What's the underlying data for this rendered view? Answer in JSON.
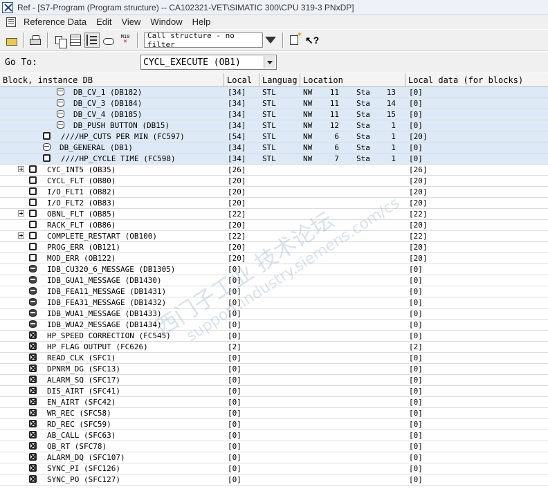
{
  "window": {
    "title": "Ref - [S7-Program (Program structure) -- CA102321-VET\\SIMATIC 300\\CPU 319-3 PNxDP]"
  },
  "menu": {
    "items": [
      "Reference Data",
      "Edit",
      "View",
      "Window",
      "Help"
    ]
  },
  "toolbar": {
    "icons": [
      "open-icon",
      "print-icon",
      "copy-icon",
      "grid-view-icon",
      "tree-view-icon",
      "connection-icon",
      "m10-icon",
      "filter-icon",
      "new-window-icon",
      "help-icon"
    ],
    "filter_text": "Call structure - no filter",
    "m10_label": "M10"
  },
  "goto": {
    "label": "Go To:",
    "selected": "CYCL_EXECUTE (OB1)"
  },
  "grid": {
    "headers": {
      "block": "Block, instance DB",
      "local": "Local",
      "language": "Languag",
      "location": "Location",
      "local_data": "Local data (for blocks)"
    },
    "rows": [
      {
        "icon": "db",
        "name": "DB_CV_1 (DB182)",
        "local": "[34]",
        "lang": "STL",
        "loc_a": "NW",
        "loc_b": "11",
        "loc_c": "Sta",
        "loc_d": "13",
        "data": "[0]"
      },
      {
        "icon": "db",
        "name": "DB_CV_3 (DB184)",
        "local": "[34]",
        "lang": "STL",
        "loc_a": "NW",
        "loc_b": "11",
        "loc_c": "Sta",
        "loc_d": "14",
        "data": "[0]"
      },
      {
        "icon": "db",
        "name": "DB_CV_4 (DB185)",
        "local": "[34]",
        "lang": "STL",
        "loc_a": "NW",
        "loc_b": "11",
        "loc_c": "Sta",
        "loc_d": "15",
        "data": "[0]"
      },
      {
        "icon": "db",
        "name": "DB_PUSH BUTTON (DB15)",
        "local": "[34]",
        "lang": "STL",
        "loc_a": "NW",
        "loc_b": "12",
        "loc_c": "Sta",
        "loc_d": "1",
        "data": "[0]"
      },
      {
        "icon": "fc",
        "name": "////HP_CUTS PER MIN (FC597)",
        "local": "[54]",
        "lang": "STL",
        "loc_a": "NW",
        "loc_b": "6",
        "loc_c": "Sta",
        "loc_d": "1",
        "data": "[20]"
      },
      {
        "icon": "db",
        "name": "DB_GENERAL (DB1)",
        "local": "[34]",
        "lang": "STL",
        "loc_a": "NW",
        "loc_b": "6",
        "loc_c": "Sta",
        "loc_d": "1",
        "data": "[0]"
      },
      {
        "icon": "fc",
        "name": "////HP_CYCLE TIME (FC598)",
        "local": "[34]",
        "lang": "STL",
        "loc_a": "NW",
        "loc_b": "7",
        "loc_c": "Sta",
        "loc_d": "1",
        "data": "[0]"
      },
      {
        "icon": "ob",
        "expander": true,
        "name": "CYC_INT5 (OB35)",
        "local": "[26]",
        "lang": "",
        "loc_a": "",
        "loc_b": "",
        "loc_c": "",
        "loc_d": "",
        "data": "[26]"
      },
      {
        "icon": "ob",
        "name": "CYCL_FLT (OB80)",
        "local": "[20]",
        "lang": "",
        "loc_a": "",
        "loc_b": "",
        "loc_c": "",
        "loc_d": "",
        "data": "[20]"
      },
      {
        "icon": "ob",
        "name": "I/O_FLT1 (OB82)",
        "local": "[20]",
        "lang": "",
        "loc_a": "",
        "loc_b": "",
        "loc_c": "",
        "loc_d": "",
        "data": "[20]"
      },
      {
        "icon": "ob",
        "name": "I/O_FLT2 (OB83)",
        "local": "[20]",
        "lang": "",
        "loc_a": "",
        "loc_b": "",
        "loc_c": "",
        "loc_d": "",
        "data": "[20]"
      },
      {
        "icon": "ob",
        "expander": true,
        "name": "OBNL_FLT (OB85)",
        "local": "[22]",
        "lang": "",
        "loc_a": "",
        "loc_b": "",
        "loc_c": "",
        "loc_d": "",
        "data": "[22]"
      },
      {
        "icon": "ob",
        "name": "RACK_FLT (OB86)",
        "local": "[20]",
        "lang": "",
        "loc_a": "",
        "loc_b": "",
        "loc_c": "",
        "loc_d": "",
        "data": "[20]"
      },
      {
        "icon": "ob",
        "expander": true,
        "name": "COMPLETE_RESTART (OB100)",
        "local": "[22]",
        "lang": "",
        "loc_a": "",
        "loc_b": "",
        "loc_c": "",
        "loc_d": "",
        "data": "[22]"
      },
      {
        "icon": "ob",
        "name": "PROG_ERR (OB121)",
        "local": "[20]",
        "lang": "",
        "loc_a": "",
        "loc_b": "",
        "loc_c": "",
        "loc_d": "",
        "data": "[20]"
      },
      {
        "icon": "ob",
        "name": "MOD_ERR (OB122)",
        "local": "[20]",
        "lang": "",
        "loc_a": "",
        "loc_b": "",
        "loc_c": "",
        "loc_d": "",
        "data": "[20]"
      },
      {
        "icon": "dbf",
        "name": "IDB_CU320_6_MESSAGE (DB1305)",
        "local": "[0]",
        "lang": "",
        "loc_a": "",
        "loc_b": "",
        "loc_c": "",
        "loc_d": "",
        "data": "[0]"
      },
      {
        "icon": "dbf",
        "name": "IDB_GUA1_MESSAGE (DB1430)",
        "local": "[0]",
        "lang": "",
        "loc_a": "",
        "loc_b": "",
        "loc_c": "",
        "loc_d": "",
        "data": "[0]"
      },
      {
        "icon": "dbf",
        "name": "IDB_FEA11_MESSAGE (DB1431)",
        "local": "[0]",
        "lang": "",
        "loc_a": "",
        "loc_b": "",
        "loc_c": "",
        "loc_d": "",
        "data": "[0]"
      },
      {
        "icon": "dbf",
        "name": "IDB_FEA31_MESSAGE (DB1432)",
        "local": "[0]",
        "lang": "",
        "loc_a": "",
        "loc_b": "",
        "loc_c": "",
        "loc_d": "",
        "data": "[0]"
      },
      {
        "icon": "dbf",
        "name": "IDB_WUA1_MESSAGE (DB1433)",
        "local": "[0]",
        "lang": "",
        "loc_a": "",
        "loc_b": "",
        "loc_c": "",
        "loc_d": "",
        "data": "[0]"
      },
      {
        "icon": "dbf",
        "name": "IDB_WUA2_MESSAGE (DB1434)",
        "local": "[0]",
        "lang": "",
        "loc_a": "",
        "loc_b": "",
        "loc_c": "",
        "loc_d": "",
        "data": "[0]"
      },
      {
        "icon": "sfc",
        "name": "HP_SPEED CORRECTION (FC545)",
        "local": "[0]",
        "lang": "",
        "loc_a": "",
        "loc_b": "",
        "loc_c": "",
        "loc_d": "",
        "data": "[0]"
      },
      {
        "icon": "sfc",
        "name": "HP_FLAG OUTPUT (FC626)",
        "local": "[2]",
        "lang": "",
        "loc_a": "",
        "loc_b": "",
        "loc_c": "",
        "loc_d": "",
        "data": "[2]"
      },
      {
        "icon": "sfc",
        "name": "READ_CLK (SFC1)",
        "local": "[0]",
        "lang": "",
        "loc_a": "",
        "loc_b": "",
        "loc_c": "",
        "loc_d": "",
        "data": "[0]"
      },
      {
        "icon": "sfc",
        "name": "DPNRM_DG (SFC13)",
        "local": "[0]",
        "lang": "",
        "loc_a": "",
        "loc_b": "",
        "loc_c": "",
        "loc_d": "",
        "data": "[0]"
      },
      {
        "icon": "sfc",
        "name": "ALARM_SQ (SFC17)",
        "local": "[0]",
        "lang": "",
        "loc_a": "",
        "loc_b": "",
        "loc_c": "",
        "loc_d": "",
        "data": "[0]"
      },
      {
        "icon": "sfc",
        "name": "DIS_AIRT (SFC41)",
        "local": "[0]",
        "lang": "",
        "loc_a": "",
        "loc_b": "",
        "loc_c": "",
        "loc_d": "",
        "data": "[0]"
      },
      {
        "icon": "sfc",
        "name": "EN_AIRT (SFC42)",
        "local": "[0]",
        "lang": "",
        "loc_a": "",
        "loc_b": "",
        "loc_c": "",
        "loc_d": "",
        "data": "[0]"
      },
      {
        "icon": "sfc",
        "name": "WR_REC (SFC58)",
        "local": "[0]",
        "lang": "",
        "loc_a": "",
        "loc_b": "",
        "loc_c": "",
        "loc_d": "",
        "data": "[0]"
      },
      {
        "icon": "sfc",
        "name": "RD_REC (SFC59)",
        "local": "[0]",
        "lang": "",
        "loc_a": "",
        "loc_b": "",
        "loc_c": "",
        "loc_d": "",
        "data": "[0]"
      },
      {
        "icon": "sfc",
        "name": "AB_CALL (SFC63)",
        "local": "[0]",
        "lang": "",
        "loc_a": "",
        "loc_b": "",
        "loc_c": "",
        "loc_d": "",
        "data": "[0]"
      },
      {
        "icon": "sfc",
        "name": "OB_RT (SFC78)",
        "local": "[0]",
        "lang": "",
        "loc_a": "",
        "loc_b": "",
        "loc_c": "",
        "loc_d": "",
        "data": "[0]"
      },
      {
        "icon": "sfc",
        "name": "ALARM_DQ (SFC107)",
        "local": "[0]",
        "lang": "",
        "loc_a": "",
        "loc_b": "",
        "loc_c": "",
        "loc_d": "",
        "data": "[0]"
      },
      {
        "icon": "sfc",
        "name": "SYNC_PI (SFC126)",
        "local": "[0]",
        "lang": "",
        "loc_a": "",
        "loc_b": "",
        "loc_c": "",
        "loc_d": "",
        "data": "[0]"
      },
      {
        "icon": "sfc",
        "name": "SYNC_PO (SFC127)",
        "local": "[0]",
        "lang": "",
        "loc_a": "",
        "loc_b": "",
        "loc_c": "",
        "loc_d": "",
        "data": "[0]"
      }
    ]
  },
  "watermark": {
    "line1": "西门子工业 技术论坛",
    "line2": "support.industry.siemens.com/cs"
  },
  "colors": {
    "row_highlight": "#dde9f6",
    "header_bg": "#f3f3f3",
    "window_bg": "#f0f0f0"
  }
}
